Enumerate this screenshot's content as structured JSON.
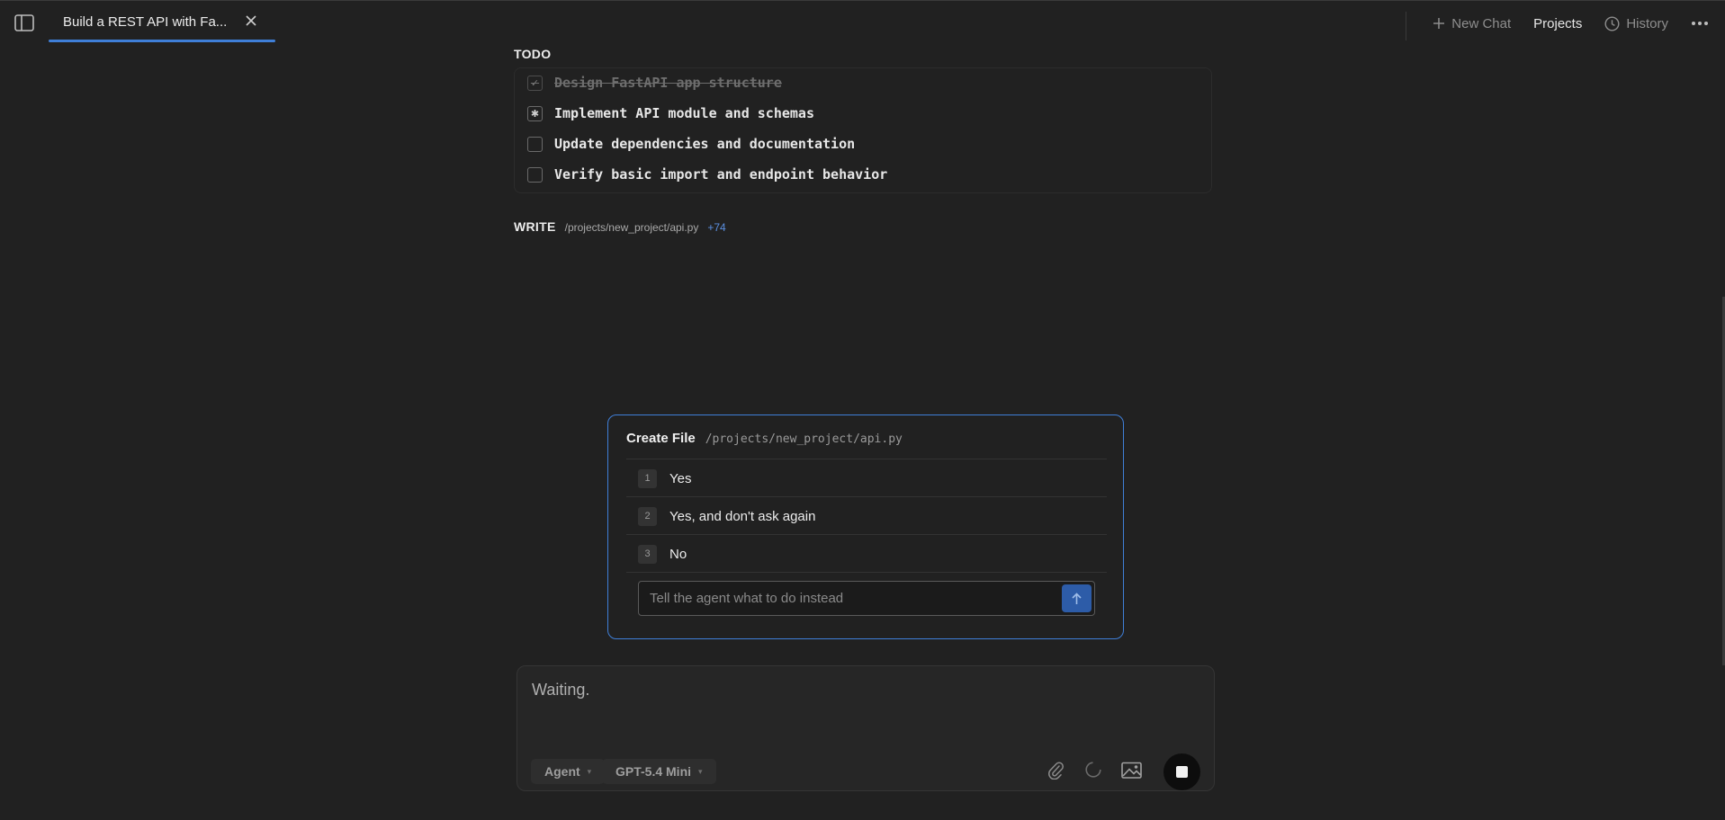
{
  "tab": {
    "title": "Build a REST API with Fa..."
  },
  "top_actions": {
    "new_chat": "New Chat",
    "projects": "Projects",
    "history": "History"
  },
  "todo": {
    "label": "TODO",
    "items": [
      {
        "text": "Design FastAPI app structure",
        "status": "done"
      },
      {
        "text": "Implement API module and schemas",
        "status": "in-progress"
      },
      {
        "text": "Update dependencies and documentation",
        "status": "pending"
      },
      {
        "text": "Verify basic import and endpoint behavior",
        "status": "pending"
      }
    ]
  },
  "write": {
    "label": "WRITE",
    "path": "/projects/new_project/api.py",
    "diff": "+74"
  },
  "dialog": {
    "title": "Create File",
    "path": "/projects/new_project/api.py",
    "options": [
      {
        "num": "1",
        "label": "Yes"
      },
      {
        "num": "2",
        "label": "Yes, and don't ask again"
      },
      {
        "num": "3",
        "label": "No"
      }
    ],
    "input_placeholder": "Tell the agent what to do instead"
  },
  "composer": {
    "status_text": "Waiting.",
    "mode": "Agent",
    "model": "GPT-5.4 Mini"
  },
  "colors": {
    "accent": "#3f7fd8",
    "background": "#212121",
    "send": "#2d5ca8"
  }
}
